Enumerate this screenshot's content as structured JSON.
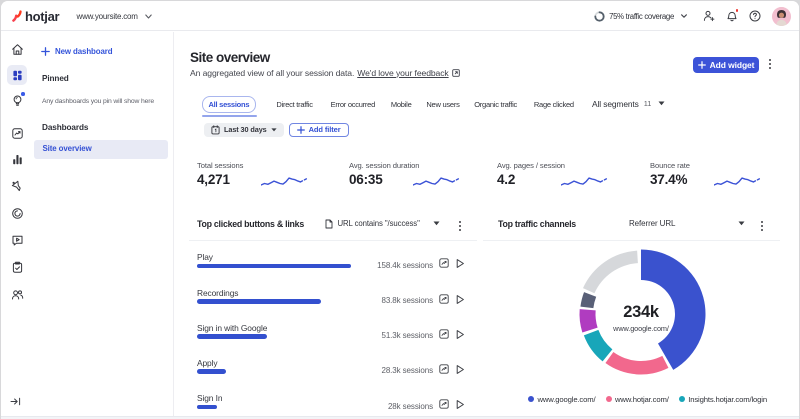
{
  "topbar": {
    "brand": "hotjar",
    "site_selector": "www.yoursite.com",
    "traffic_coverage": {
      "label": "75% traffic coverage",
      "percent": 75
    },
    "icons": [
      "traffic-ring-icon",
      "person-add-icon",
      "bell-icon",
      "help-icon",
      "avatar"
    ],
    "notification_dot_color": "#ec352f"
  },
  "sidebar": {
    "new_dashboard_label": "New dashboard",
    "pinned_header": "Pinned",
    "pinned_hint": "Any dashboards you pin will show here",
    "dashboards_header": "Dashboards",
    "active_item": "Site overview",
    "rail_icons": [
      "home-icon",
      "dashboards-icon",
      "insights-ai-icon",
      "trends-icon",
      "metrics-icon",
      "funnels-icon",
      "heatmaps-icon",
      "recordings-icon",
      "surveys-icon",
      "interviews-icon"
    ],
    "rail_selected": "dashboards-icon",
    "collapse_icon": "collapse-sidebar-icon"
  },
  "page": {
    "title": "Site overview",
    "subtitle": "An aggregated view of all your session data.",
    "feedback_link": "We'd love your feedback",
    "add_widget_label": "Add widget"
  },
  "filters": {
    "tabs": [
      "All sessions",
      "Direct traffic",
      "Error occurred",
      "Mobile",
      "New users",
      "Organic traffic",
      "Rage clicked"
    ],
    "active_tab": "All sessions",
    "segments_label": "All segments",
    "segments_count": "11",
    "date_range_label": "Last 30 days",
    "add_filter_label": "Add filter"
  },
  "metrics": [
    {
      "label": "Total sessions",
      "value": "4,271"
    },
    {
      "label": "Avg. session duration",
      "value": "06:35"
    },
    {
      "label": "Avg. pages / session",
      "value": "4.2"
    },
    {
      "label": "Bounce rate",
      "value": "37.4%"
    }
  ],
  "sparkline": {
    "color": "#3b52d6",
    "solid": [
      [
        0,
        8.5
      ],
      [
        3.5,
        7
      ],
      [
        7,
        7.8
      ],
      [
        10,
        6.2
      ],
      [
        13,
        4.6
      ],
      [
        16,
        5.8
      ],
      [
        19,
        7
      ],
      [
        22,
        7.6
      ],
      [
        25,
        5.2
      ],
      [
        28,
        1.6
      ],
      [
        31,
        2.6
      ],
      [
        34,
        3.2
      ],
      [
        37,
        4.6
      ],
      [
        39.5,
        5.4
      ]
    ],
    "dashed": [
      [
        39.5,
        5.4
      ],
      [
        46,
        2
      ]
    ]
  },
  "widgets": {
    "top_clicked": {
      "title": "Top clicked buttons & links",
      "filter_icon": "page-icon",
      "filter_label": "URL contains \"/success\"",
      "row_icons": [
        "open-in-trends-icon",
        "play-recordings-icon"
      ],
      "chart_data": {
        "type": "bar",
        "bar_color": "#3350cf",
        "rows": [
          {
            "label": "Play",
            "sessions": "158.4k sessions",
            "bar_pct": 100
          },
          {
            "label": "Recordings",
            "sessions": "83.8k sessions",
            "bar_pct": 80.5
          },
          {
            "label": "Sign in with Google",
            "sessions": "51.3k sessions",
            "bar_pct": 45.5
          },
          {
            "label": "Apply",
            "sessions": "28.3k sessions",
            "bar_pct": 18.8
          },
          {
            "label": "Sign In",
            "sessions": "28k sessions",
            "bar_pct": 13
          }
        ]
      }
    },
    "traffic_channels": {
      "title": "Top traffic channels",
      "dropdown_label": "Referrer URL",
      "center_value": "234k",
      "center_label": "www.google.com/",
      "chart_data": {
        "type": "donut",
        "segments": [
          {
            "name": "www.google.com/",
            "color": "#3a52ce",
            "start": 0,
            "end": 150,
            "outer": 64.5,
            "inner": 34
          },
          {
            "name": "www.hotjar.com/",
            "color": "#f2688d",
            "start": 153,
            "end": 216,
            "outer": 60.5,
            "inner": 47
          },
          {
            "name": "insights.hotjar.com/login",
            "color": "#18a6b9",
            "start": 219,
            "end": 249.5,
            "outer": 61,
            "inner": 45.5
          },
          {
            "name": "other-1",
            "color": "#b03cc0",
            "start": 252.5,
            "end": 274.5,
            "outer": 61.5,
            "inner": 45.5
          },
          {
            "name": "other-2",
            "color": "#596077",
            "start": 277,
            "end": 291,
            "outer": 61,
            "inner": 48
          },
          {
            "name": "other-3",
            "color": "#d6d8db",
            "start": 294,
            "end": 356.5,
            "outer": 63.5,
            "inner": 51
          }
        ]
      },
      "legend": [
        {
          "label": "www.google.com/",
          "color": "#3a52ce"
        },
        {
          "label": "www.hotjar.com/",
          "color": "#f2688d"
        },
        {
          "label": "Insights.hotjar.com/login",
          "color": "#18a6b9"
        }
      ]
    }
  }
}
